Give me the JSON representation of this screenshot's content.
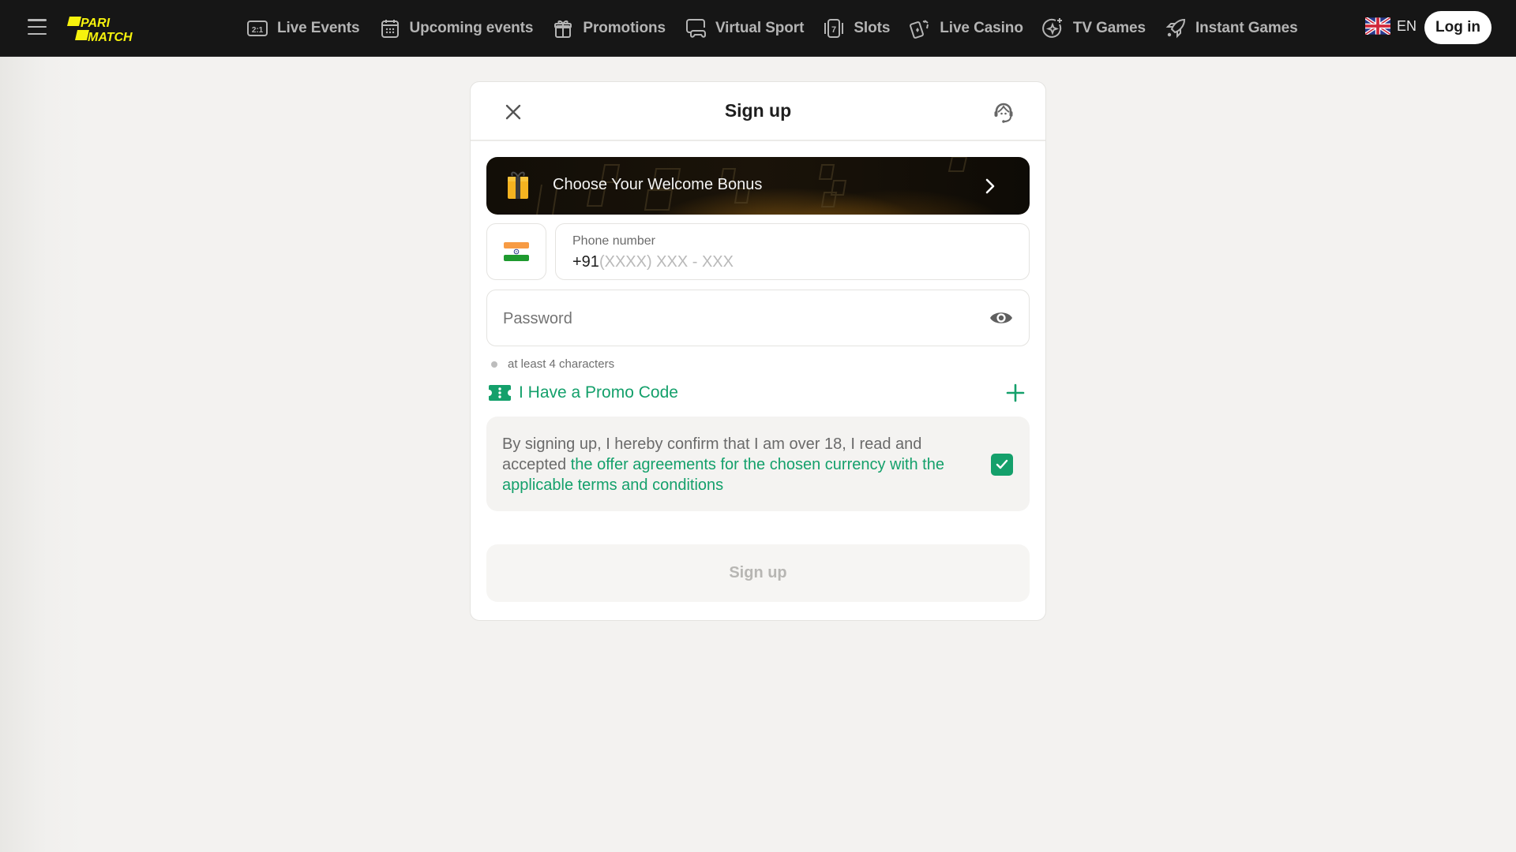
{
  "header": {
    "brand_line1": "PARI",
    "brand_line2": "MATCH",
    "brand_color": "#f6f20d",
    "nav": [
      {
        "label": "Live Events",
        "icon": "score-2-1-icon"
      },
      {
        "label": "Upcoming events",
        "icon": "calendar-icon"
      },
      {
        "label": "Promotions",
        "icon": "gift-icon"
      },
      {
        "label": "Virtual Sport",
        "icon": "gamepad-screen-icon"
      },
      {
        "label": "Slots",
        "icon": "slot-seven-icon"
      },
      {
        "label": "Live Casino",
        "icon": "playing-cards-icon"
      },
      {
        "label": "TV Games",
        "icon": "sparkle-circle-icon"
      },
      {
        "label": "Instant Games",
        "icon": "rocket-icon"
      }
    ],
    "language": "EN",
    "login_label": "Log in"
  },
  "modal": {
    "title": "Sign up",
    "bonus_banner": "Choose Your Welcome Bonus",
    "phone": {
      "label": "Phone number",
      "prefix": "+91",
      "placeholder": "(XXXX) XXX - XXX",
      "country": "India"
    },
    "password": {
      "placeholder": "Password",
      "hint": "at least 4 characters"
    },
    "promo_label": "I Have a Promo Code",
    "terms": {
      "text_before": "By signing up, I hereby confirm that I am over 18, I read and accepted ",
      "link_text": "the offer agreements for the chosen currency with the applicable terms and conditions",
      "checked": true
    },
    "submit_label": "Sign up"
  },
  "colors": {
    "accent_green": "#14a06b",
    "topbar_bg": "#161616"
  }
}
